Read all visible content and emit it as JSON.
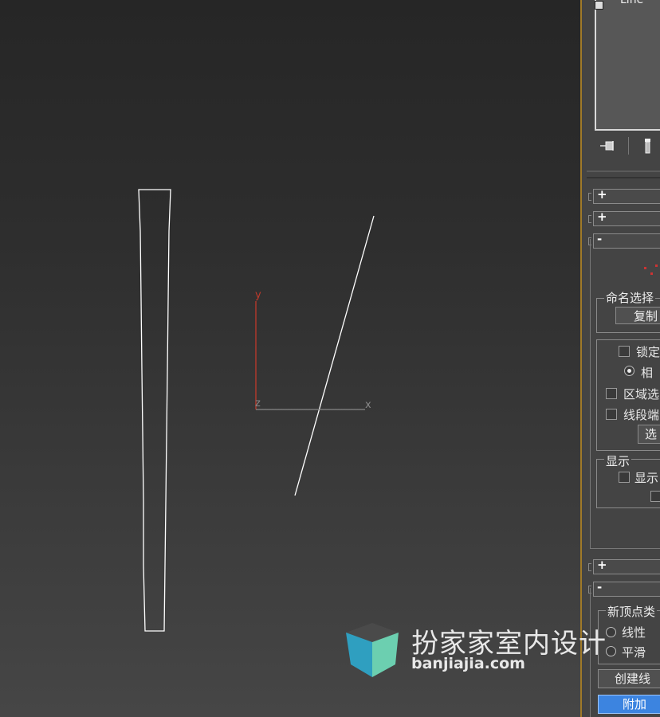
{
  "viewport": {
    "axis_labels": {
      "y": "y",
      "z": "z",
      "x": "x"
    },
    "colors": {
      "shape": "#ffffff",
      "y_axis": "#c0392b",
      "x_axis": "#888888"
    }
  },
  "panel": {
    "object_list": {
      "item": "Line"
    },
    "toolbar_icons": [
      "pin-stack-icon",
      "show-end-result-icon"
    ],
    "rollouts": [
      "+",
      "+",
      "-"
    ],
    "named_selection": {
      "title": "命名选择",
      "copy_button": "复制"
    },
    "selection": {
      "lock": "锁定",
      "relative": "相",
      "area_select": "区域选",
      "segment_end": "线段端",
      "select_button": "选"
    },
    "display": {
      "title": "显示",
      "show": "显示"
    },
    "rollouts2": [
      "+",
      "-"
    ],
    "new_vertex": {
      "title": "新顶点类",
      "linear": "线性",
      "smooth": "平滑"
    },
    "create_line_button": "创建线",
    "attach_button": "附加"
  },
  "watermark": {
    "title": "扮家家室内设计",
    "subtitle": "banjiajia.com"
  }
}
